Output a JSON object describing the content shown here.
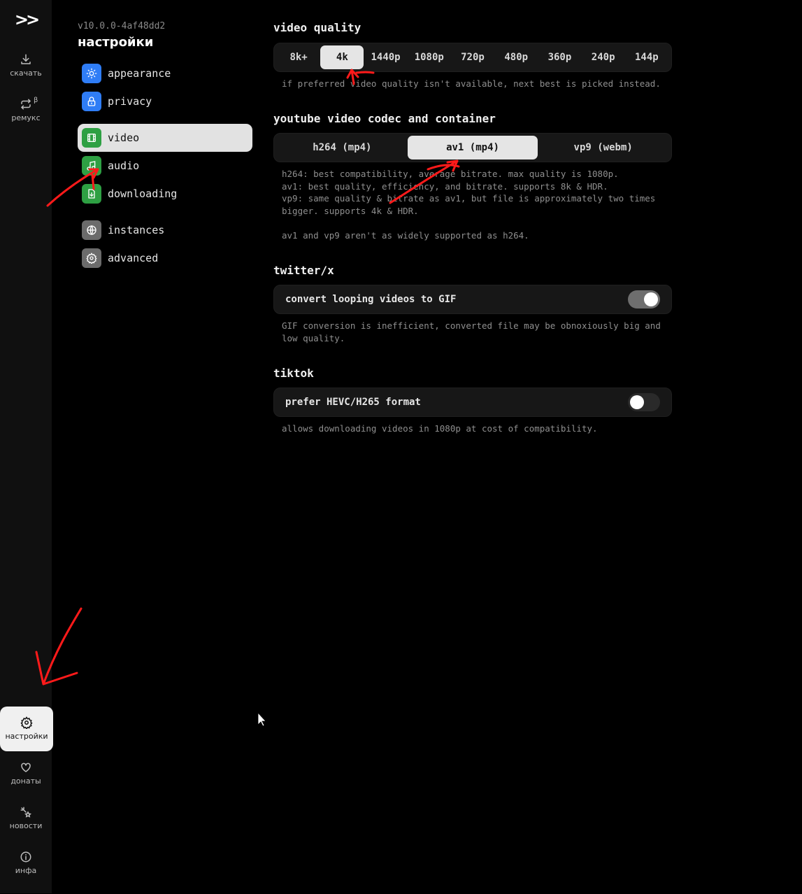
{
  "rail": {
    "logo": ">>",
    "download_label": "скачать",
    "remux_label": "ремукс",
    "remux_badge": "β",
    "settings_label": "настройки",
    "donate_label": "донаты",
    "news_label": "новости",
    "info_label": "инфа"
  },
  "settings": {
    "version": "v10.0.0-4af48dd2",
    "title": "настройки",
    "nav": [
      {
        "label": "appearance",
        "icon": "sun-icon",
        "color": "#2f7df6"
      },
      {
        "label": "privacy",
        "icon": "lock-icon",
        "color": "#2f7df6"
      },
      {
        "label": "video",
        "icon": "film-icon",
        "color": "#2ea043"
      },
      {
        "label": "audio",
        "icon": "music-icon",
        "color": "#2ea043"
      },
      {
        "label": "downloading",
        "icon": "file-download-icon",
        "color": "#2ea043"
      },
      {
        "label": "instances",
        "icon": "globe-icon",
        "color": "#6b6b6b"
      },
      {
        "label": "advanced",
        "icon": "gear-icon",
        "color": "#6b6b6b"
      }
    ],
    "active_nav": "video"
  },
  "video_quality": {
    "title": "video quality",
    "options": [
      "8k+",
      "4k",
      "1440p",
      "1080p",
      "720p",
      "480p",
      "360p",
      "240p",
      "144p"
    ],
    "selected": "4k",
    "hint": "if preferred video quality isn't available, next best is picked instead."
  },
  "codec": {
    "title": "youtube video codec and container",
    "options": [
      "h264 (mp4)",
      "av1 (mp4)",
      "vp9 (webm)"
    ],
    "selected": "av1 (mp4)",
    "hint": "h264: best compatibility, average bitrate. max quality is 1080p.\nav1: best quality, efficiency, and bitrate. supports 8k & HDR.\nvp9: same quality & bitrate as av1, but file is approximately two times\nbigger. supports 4k & HDR.\n\nav1 and vp9 aren't as widely supported as h264."
  },
  "twitter": {
    "title": "twitter/x",
    "toggle_label": "convert looping videos to GIF",
    "toggle_on": true,
    "hint": "GIF conversion is inefficient, converted file may be obnoxiously big and\nlow quality."
  },
  "tiktok": {
    "title": "tiktok",
    "toggle_label": "prefer HEVC/H265 format",
    "toggle_on": false,
    "hint": "allows downloading videos in 1080p at cost of compatibility."
  }
}
